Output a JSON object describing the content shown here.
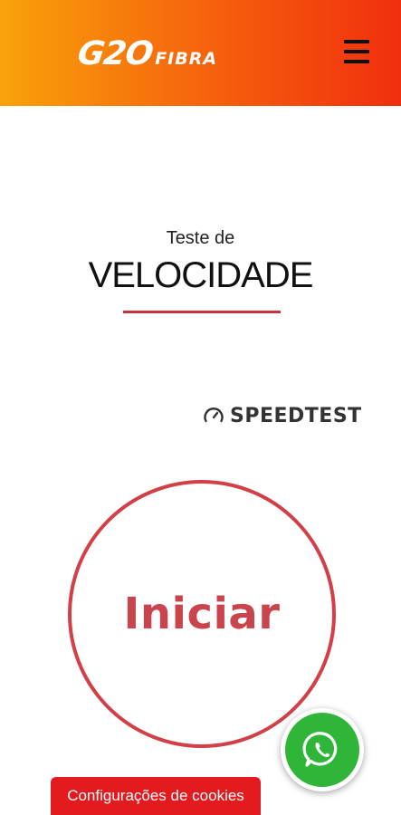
{
  "header": {
    "logo_main": "G2O",
    "logo_sub": "FIBRA",
    "menu_icon": "hamburger-menu-icon",
    "gradient_colors": [
      "#f9a20a",
      "#f66a0c",
      "#f02e0e"
    ]
  },
  "main": {
    "subtitle": "Teste de",
    "title": "VELOCIDADE",
    "accent_color": "#c8363d",
    "speedtest_brand": "SPEEDTEST",
    "speedtest_icon": "speedometer-icon",
    "start_label": "Iniciar"
  },
  "floating": {
    "whatsapp_icon": "whatsapp-icon",
    "whatsapp_color": "#2fb537"
  },
  "cookie_bar": {
    "label": "Configurações de cookies",
    "color": "#e31b1f"
  }
}
